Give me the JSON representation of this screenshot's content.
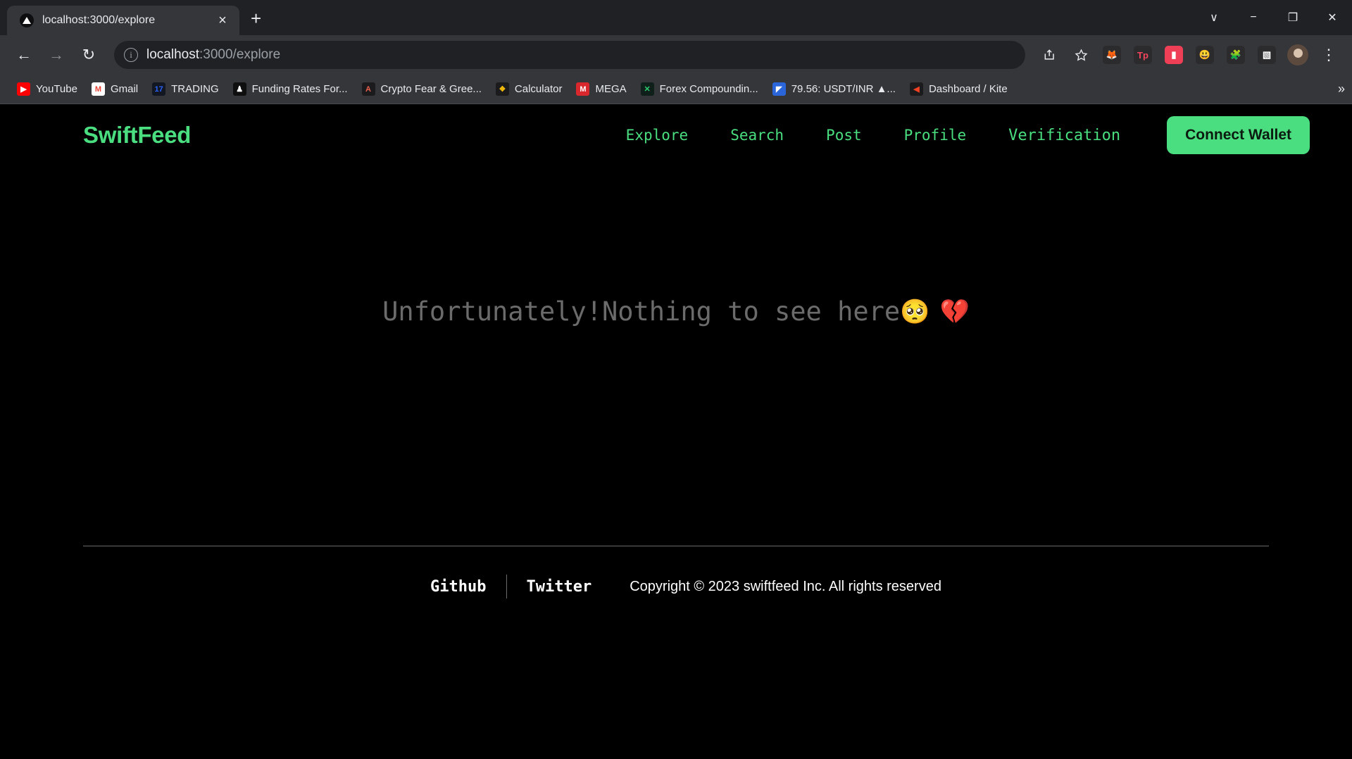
{
  "browser": {
    "tab": {
      "title": "localhost:3000/explore",
      "favicon": "triangle-play-icon",
      "close": "×"
    },
    "new_tab_label": "+",
    "window_controls": {
      "minimize_group": "∨",
      "minimize": "−",
      "maximize": "❐",
      "close": "✕"
    },
    "toolbar": {
      "back": "←",
      "forward": "→",
      "reload": "↻",
      "site_info": "i",
      "url_host": "localhost",
      "url_rest": ":3000/explore",
      "share": "share-icon",
      "bookmark_star": "☆",
      "menu": "⋮"
    },
    "extensions": [
      {
        "name": "metamask-extension",
        "glyph": "🦊",
        "color": "#2b2b2e"
      },
      {
        "name": "tp-wallet-extension",
        "glyph": "Tp",
        "color": "#2b2b2e",
        "text_color": "#f5455c"
      },
      {
        "name": "pocket-extension",
        "glyph": "▮",
        "color": "#ef3f56"
      },
      {
        "name": "smiley-extension",
        "glyph": "😃",
        "color": "#2b2b2e"
      },
      {
        "name": "extensions-puzzle-icon",
        "glyph": "🧩",
        "color": "#2b2b2e"
      },
      {
        "name": "side-panel-icon",
        "glyph": "▧",
        "color": "#2b2b2e"
      }
    ],
    "bookmarks": [
      {
        "label": "YouTube",
        "icon": "youtube-icon",
        "glyph": "▶",
        "bg": "#ff0000",
        "fg": "#ffffff"
      },
      {
        "label": "Gmail",
        "icon": "gmail-icon",
        "glyph": "M",
        "bg": "#ffffff",
        "fg": "#ea4335"
      },
      {
        "label": "TRADING",
        "icon": "tradingview-icon",
        "glyph": "17",
        "bg": "#131722",
        "fg": "#2962ff"
      },
      {
        "label": "Funding Rates For...",
        "icon": "funding-icon",
        "glyph": "♟",
        "bg": "#0f0f0f",
        "fg": "#ffffff"
      },
      {
        "label": "Crypto Fear & Gree...",
        "icon": "alternative-icon",
        "glyph": "A",
        "bg": "#1b1b1d",
        "fg": "#e8604c"
      },
      {
        "label": "Calculator",
        "icon": "binance-icon",
        "glyph": "❖",
        "bg": "#1b1b1d",
        "fg": "#f0b90b"
      },
      {
        "label": "MEGA",
        "icon": "mega-icon",
        "glyph": "M",
        "bg": "#d9272e",
        "fg": "#ffffff"
      },
      {
        "label": "Forex Compoundin...",
        "icon": "forex-icon",
        "glyph": "✕",
        "bg": "#0f1f1a",
        "fg": "#2ecc71"
      },
      {
        "label": "79.56: USDT/INR ▲...",
        "icon": "chart-icon",
        "glyph": "◤",
        "bg": "#2a66d9",
        "fg": "#ffffff"
      },
      {
        "label": "Dashboard / Kite",
        "icon": "kite-icon",
        "glyph": "◀",
        "bg": "#1b1b1d",
        "fg": "#ef4123"
      }
    ],
    "bookmarks_overflow": "»"
  },
  "site": {
    "brand": "SwiftFeed",
    "nav": [
      {
        "label": "Explore"
      },
      {
        "label": "Search"
      },
      {
        "label": "Post"
      },
      {
        "label": "Profile"
      },
      {
        "label": "Verification"
      }
    ],
    "connect_wallet": "Connect Wallet",
    "empty_state": {
      "text": "Unfortunately!Nothing to see here",
      "emoji_face": "🥺",
      "emoji_heart": "💔"
    },
    "footer": {
      "github": "Github",
      "twitter": "Twitter",
      "copyright": "Copyright © 2023 swiftfeed Inc. All rights reserved"
    },
    "colors": {
      "accent": "#4ade80",
      "background": "#000000",
      "muted_text": "#6b6b6b"
    }
  }
}
